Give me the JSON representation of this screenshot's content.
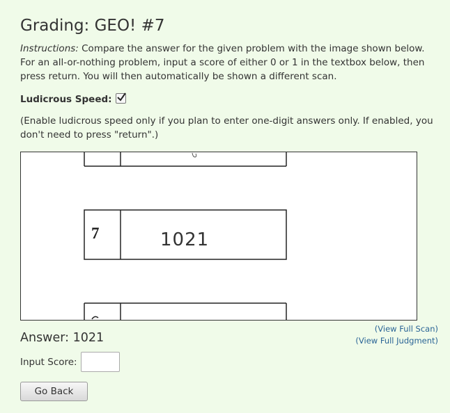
{
  "page": {
    "title": "Grading: GEO! #7"
  },
  "instructions": {
    "label": "Instructions:",
    "text": " Compare the answer for the given problem with the image shown below. For an all-or-nothing problem, input a score of either 0 or 1 in the textbox below, then press return. You will then automatically be shown a different scan."
  },
  "ludicrous": {
    "label": "Ludicrous Speed:",
    "checked": true,
    "note": "(Enable ludicrous speed only if you plan to enter one-digit answers only. If enabled, you don't need to press \"return\".)"
  },
  "scan": {
    "problem_number": "7",
    "handwritten_answer": "1021"
  },
  "links": {
    "view_full_scan": "(View Full Scan)",
    "view_full_judgment": "(View Full Judgment)"
  },
  "answer": {
    "text": "Answer: 1021"
  },
  "score": {
    "label": "Input Score:",
    "value": "",
    "placeholder": ""
  },
  "actions": {
    "go_back": "Go Back"
  }
}
